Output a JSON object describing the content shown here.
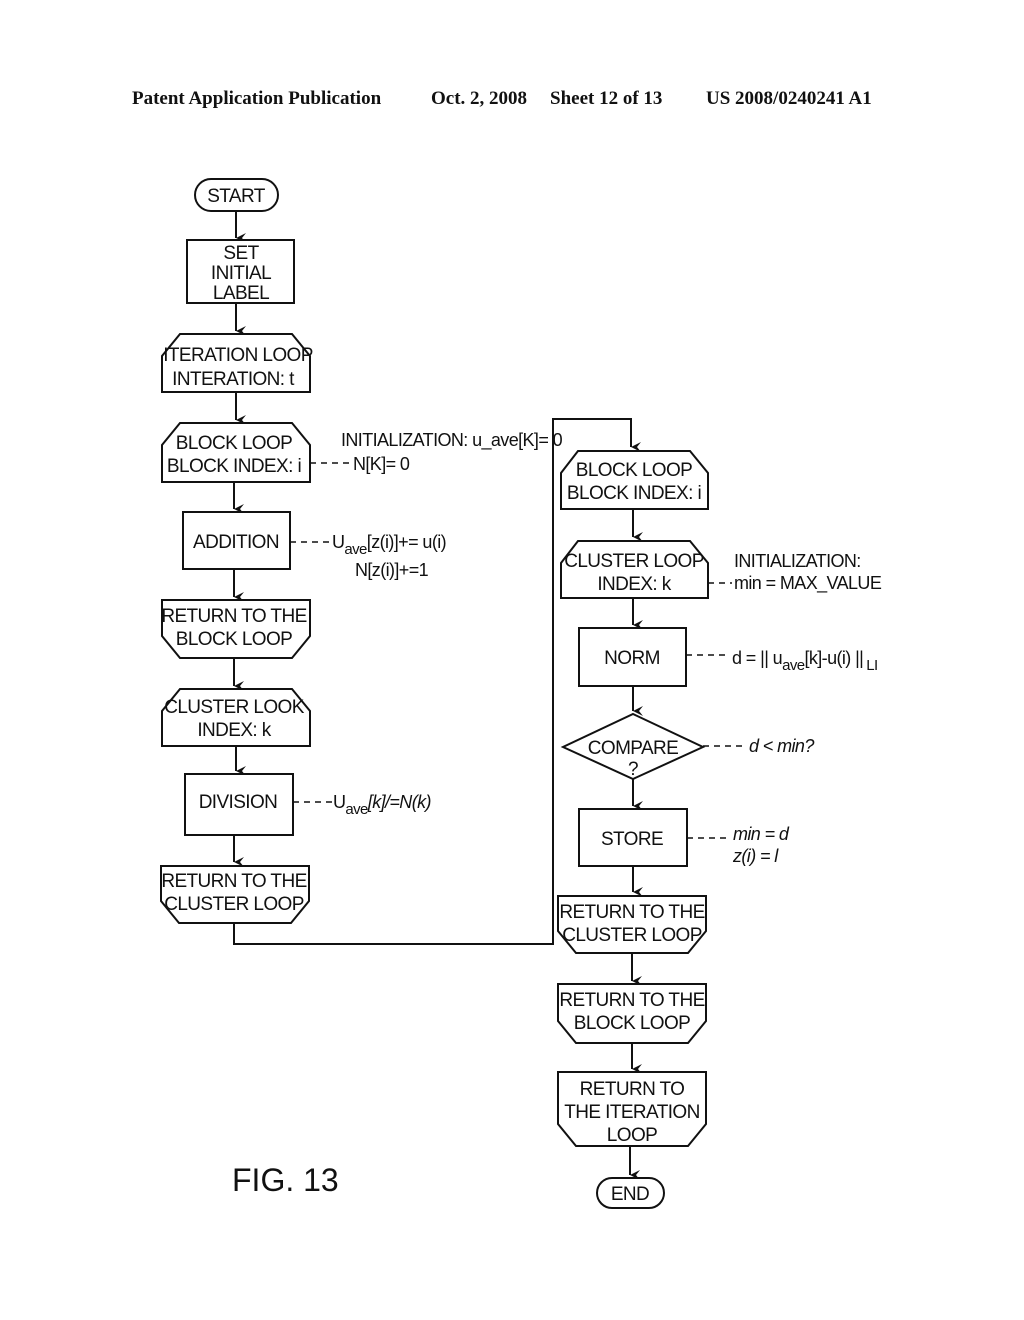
{
  "header": {
    "left": "Patent Application Publication",
    "date": "Oct. 2, 2008",
    "sheet": "Sheet 12 of 13",
    "number": "US 2008/0240241 A1"
  },
  "figure_label": "FIG. 13",
  "left_column": {
    "start": "START",
    "set_initial_label": [
      "SET",
      "INITIAL",
      "LABEL"
    ],
    "iteration_loop": [
      "ITERATION LOOP",
      "INTERATION: t"
    ],
    "block_loop": [
      "BLOCK LOOP",
      "BLOCK INDEX: i"
    ],
    "block_loop_note": [
      "INITIALIZATION: u_ave[K]= 0",
      "N[K]= 0"
    ],
    "addition": "ADDITION",
    "addition_note": {
      "line1_main": "U",
      "line1_sub": "ave",
      "line1_rest": "[z(i)]+= u(i)",
      "line2": "N[z(i)]+=1"
    },
    "return_block": [
      "RETURN TO THE",
      "BLOCK LOOP"
    ],
    "cluster_look": [
      "CLUSTER LOOK",
      "INDEX: k"
    ],
    "division": "DIVISION",
    "division_note": {
      "main": "U",
      "sub": "ave",
      "rest": "[k]/=N(k)"
    },
    "return_cluster": [
      "RETURN TO THE",
      "CLUSTER LOOP"
    ]
  },
  "right_column": {
    "block_loop": [
      "BLOCK LOOP",
      "BLOCK INDEX: i"
    ],
    "cluster_loop": [
      "CLUSTER LOOP",
      "INDEX: k"
    ],
    "cluster_loop_note": [
      "INITIALIZATION:",
      "min = MAX_VALUE"
    ],
    "norm": "NORM",
    "norm_note": {
      "pre": "d = || u",
      "sub": "ave",
      "rest": "[k]-u(i) ||",
      "sub2": "LI"
    },
    "compare": [
      "COMPARE",
      "?"
    ],
    "compare_note": "d < min?",
    "store": "STORE",
    "store_note": [
      "min = d",
      "z(i) = l"
    ],
    "return_cluster": [
      "RETURN TO THE",
      "CLUSTER LOOP"
    ],
    "return_block": [
      "RETURN TO THE",
      "BLOCK LOOP"
    ],
    "return_iteration": [
      "RETURN TO",
      "THE ITERATION",
      "LOOP"
    ],
    "end": "END"
  }
}
